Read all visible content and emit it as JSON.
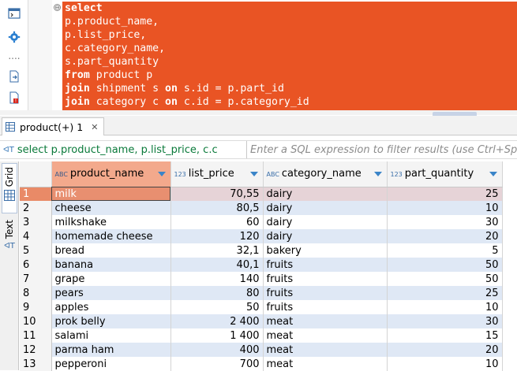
{
  "editor": {
    "lines": [
      [
        {
          "t": "select",
          "kw": true
        }
      ],
      [
        {
          "t": "p.product_name,",
          "kw": false
        }
      ],
      [
        {
          "t": "p.list_price,",
          "kw": false
        }
      ],
      [
        {
          "t": "c.category_name,",
          "kw": false
        }
      ],
      [
        {
          "t": "s.part_quantity",
          "kw": false
        }
      ],
      [
        {
          "t": "from",
          "kw": true
        },
        {
          "t": " product p",
          "kw": false
        }
      ],
      [
        {
          "t": "join",
          "kw": true
        },
        {
          "t": " shipment s ",
          "kw": false
        },
        {
          "t": "on",
          "kw": true
        },
        {
          "t": " s.id = p.part_id",
          "kw": false
        }
      ],
      [
        {
          "t": "join",
          "kw": true
        },
        {
          "t": " category c ",
          "kw": false
        },
        {
          "t": "on",
          "kw": true
        },
        {
          "t": " c.id = p.category_id",
          "kw": false
        }
      ]
    ],
    "fold_glyph": "⊖",
    "highlight_color": "#e95424"
  },
  "rail_icons": [
    "terminal-icon",
    "gear-icon",
    "more-dots-icon",
    "export-icon",
    "document-error-icon"
  ],
  "results_tab": {
    "label": "product(+) 1",
    "close": "✕"
  },
  "filter": {
    "query_icon": "ᐊT",
    "query": "select p.product_name, p.list_price, c.c",
    "placeholder": "Enter a SQL expression to filter results (use Ctrl+Space)"
  },
  "side_tabs": {
    "grid": "Grid",
    "text": "Text"
  },
  "grid": {
    "columns": [
      {
        "type": "ABC",
        "name": "product_name"
      },
      {
        "type": "123",
        "name": "list_price"
      },
      {
        "type": "ABC",
        "name": "category_name"
      },
      {
        "type": "123",
        "name": "part_quantity"
      }
    ],
    "rows": [
      [
        "1",
        "milk",
        "70,55",
        "dairy",
        "25"
      ],
      [
        "2",
        "cheese",
        "80,5",
        "dairy",
        "10"
      ],
      [
        "3",
        "milkshake",
        "60",
        "dairy",
        "30"
      ],
      [
        "4",
        "homemade cheese",
        "120",
        "dairy",
        "20"
      ],
      [
        "5",
        "bread",
        "32,1",
        "bakery",
        "5"
      ],
      [
        "6",
        "banana",
        "40,1",
        "fruits",
        "50"
      ],
      [
        "7",
        "grape",
        "140",
        "fruits",
        "50"
      ],
      [
        "8",
        "pears",
        "80",
        "fruits",
        "25"
      ],
      [
        "9",
        "apples",
        "50",
        "fruits",
        "10"
      ],
      [
        "10",
        "prok belly",
        "2 400",
        "meat",
        "30"
      ],
      [
        "11",
        "salami",
        "1 400",
        "meat",
        "15"
      ],
      [
        "12",
        "parma ham",
        "400",
        "meat",
        "20"
      ],
      [
        "13",
        "pepperoni",
        "700",
        "meat",
        "10"
      ]
    ],
    "selected_row": 0
  }
}
